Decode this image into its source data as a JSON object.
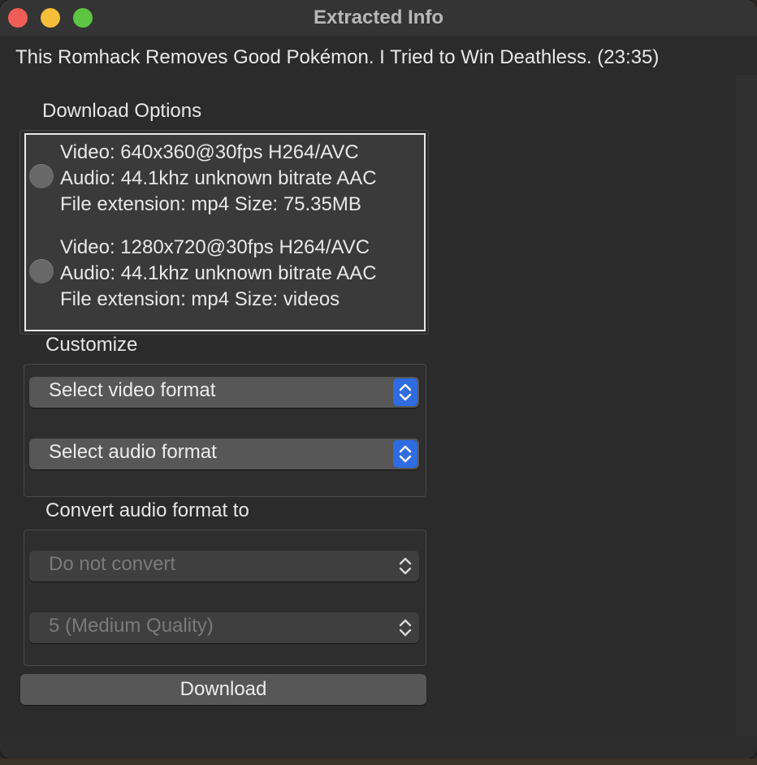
{
  "window": {
    "title": "Extracted Info"
  },
  "video": {
    "title": "This Romhack Removes Good Pokémon. I Tried to Win Deathless. (23:35)"
  },
  "download_options": {
    "label": "Download Options",
    "options": [
      {
        "video": "Video: 640x360@30fps H264/AVC",
        "audio": "Audio: 44.1khz unknown bitrate AAC",
        "file": "File extension: mp4 Size: 75.35MB"
      },
      {
        "video": "Video: 1280x720@30fps H264/AVC",
        "audio": "Audio: 44.1khz unknown bitrate AAC",
        "file": "File extension: mp4 Size: videos"
      }
    ]
  },
  "customize": {
    "label": "Customize",
    "video_format": "Select video format",
    "audio_format": "Select audio format"
  },
  "convert": {
    "label": "Convert audio format to",
    "format": "Do not convert",
    "quality": "5 (Medium Quality)"
  },
  "download_button": "Download",
  "colors": {
    "accent": "#2f6cdf",
    "close": "#ee5e56",
    "minimize": "#f5be3b",
    "maximize": "#5dc542"
  }
}
